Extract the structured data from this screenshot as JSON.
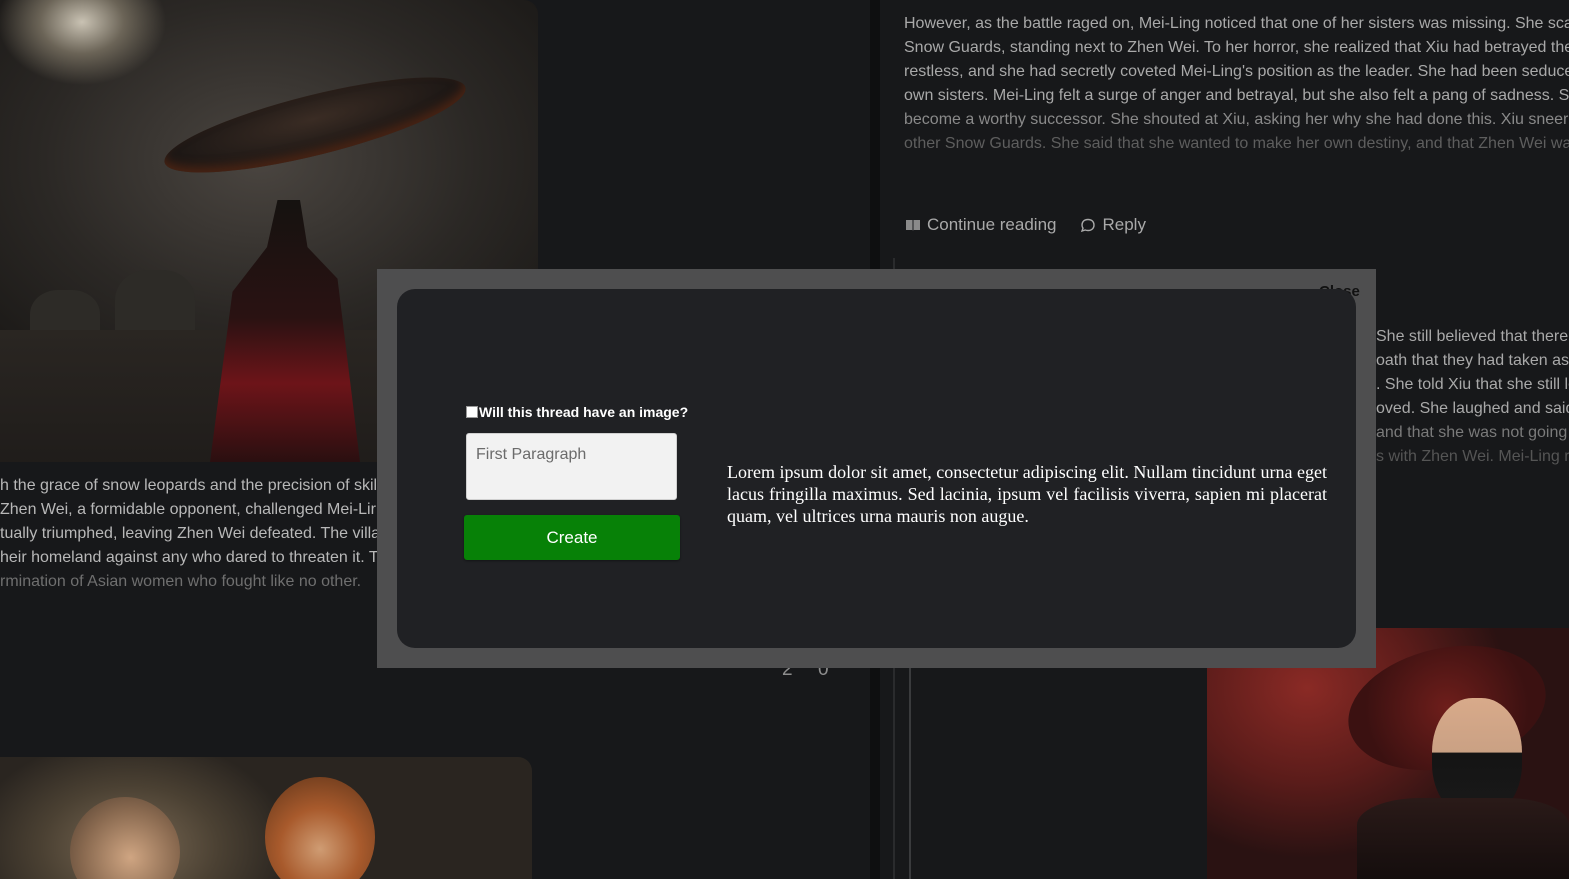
{
  "left_post": {
    "image_name": "samurai-artwork",
    "text_lines": [
      "h the grace of snow leopards and the precision of skil",
      "Zhen Wei, a formidable opponent, challenged Mei-Lir",
      "tually triumphed, leaving Zhen Wei defeated. The villag",
      "heir homeland against any who dared to threaten it. Th",
      "rmination of Asian women who fought like no other."
    ],
    "counts": [
      "2",
      "0"
    ]
  },
  "right_post": {
    "text_lines": [
      "However, as the battle raged on, Mei-Ling noticed that one of her sisters was missing. She scar",
      "Snow Guards, standing next to Zhen Wei. To her horror, she realized that Xiu had betrayed the",
      "restless, and she had secretly coveted Mei-Ling's position as the leader. She had been seduced",
      "own sisters. Mei-Ling felt a surge of anger and betrayal, but she also felt a pang of sadness. Sh",
      "become a worthy successor. She shouted at Xiu, asking her why she had done this. Xiu sneered",
      "other Snow Guards. She said that she wanted to make her own destiny, and that Zhen Wei was"
    ],
    "continue_label": "Continue reading",
    "reply_label": "Reply",
    "reply_text_lines": [
      "She still believed that there",
      "oath that they had taken as",
      ". She told Xiu that she still lo",
      "oved. She laughed and said",
      "and that she was not going",
      "s with Zhen Wei. Mei-Ling r"
    ]
  },
  "modal": {
    "close_label": "Close",
    "checkbox_label": "Will this thread have an image?",
    "checkbox_checked": false,
    "input_placeholder": "First Paragraph",
    "input_value": "",
    "create_label": "Create",
    "create_color": "#078107",
    "preview_text": "Lorem ipsum dolor sit amet, consectetur adipiscing elit. Nullam tincidunt urna eget lacus fringilla maximus. Sed lacinia, ipsum vel facilisis viverra, sapien mi placerat quam, vel ultrices urna mauris non augue."
  }
}
